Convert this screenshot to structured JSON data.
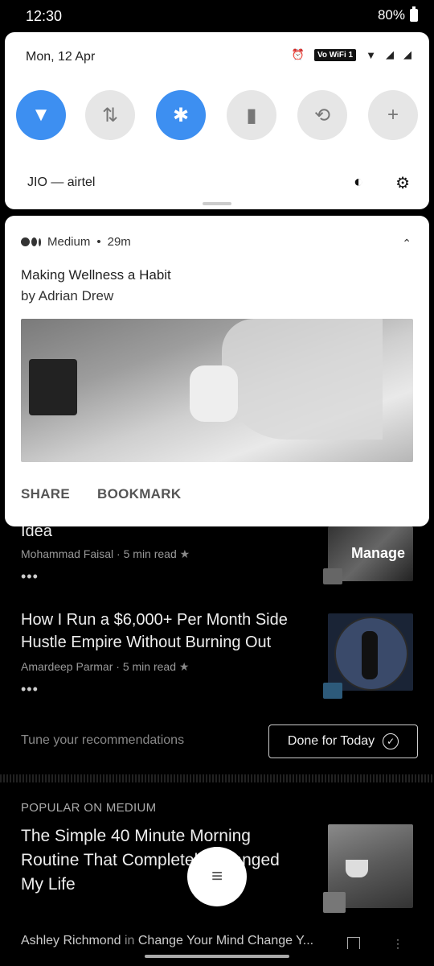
{
  "status_bar": {
    "time": "12:30",
    "battery": "80%"
  },
  "quick_settings": {
    "date": "Mon, 12 Apr",
    "wifi_badge": "Vo WiFi 1",
    "carrier": "JIO — airtel",
    "tiles": [
      {
        "name": "wifi",
        "state": "on",
        "glyph": "▼"
      },
      {
        "name": "mobile-data",
        "state": "off",
        "glyph": "⇅"
      },
      {
        "name": "bluetooth",
        "state": "on",
        "glyph": "✱"
      },
      {
        "name": "flashlight",
        "state": "off",
        "glyph": "▮"
      },
      {
        "name": "auto-rotate",
        "state": "off",
        "glyph": "⟲"
      },
      {
        "name": "battery-saver",
        "state": "off",
        "glyph": "+"
      }
    ]
  },
  "notification": {
    "app": "Medium",
    "time": "29m",
    "title": "Making Wellness a Habit",
    "subtitle": "by Adrian Drew",
    "actions": [
      "SHARE",
      "BOOKMARK"
    ]
  },
  "feed": {
    "item1": {
      "title_tail": "Idea",
      "author": "Mohammad Faisal",
      "read_time": "5 min read",
      "more": "•••"
    },
    "manage_label": "Manage",
    "item2": {
      "title_line1": "How I Run a $6,000+ Per Month Side",
      "title_line2": "Hustle Empire Without Burning Out",
      "author": "Amardeep Parmar",
      "read_time": "5 min read",
      "more": "•••"
    },
    "tune_label": "Tune your recommendations",
    "done_label": "Done for Today",
    "popular_label": "POPULAR ON MEDIUM",
    "item3": {
      "title_line1": "The Simple 40 Minute Morning",
      "title_line2": "Routine That Completely Changed",
      "title_line3": "My Life",
      "author": "Ashley Richmond",
      "in_label": "in",
      "publication": "Change Your Mind Change Y..."
    }
  },
  "colors": {
    "accent": "#3d8ff1",
    "background": "#000000"
  }
}
